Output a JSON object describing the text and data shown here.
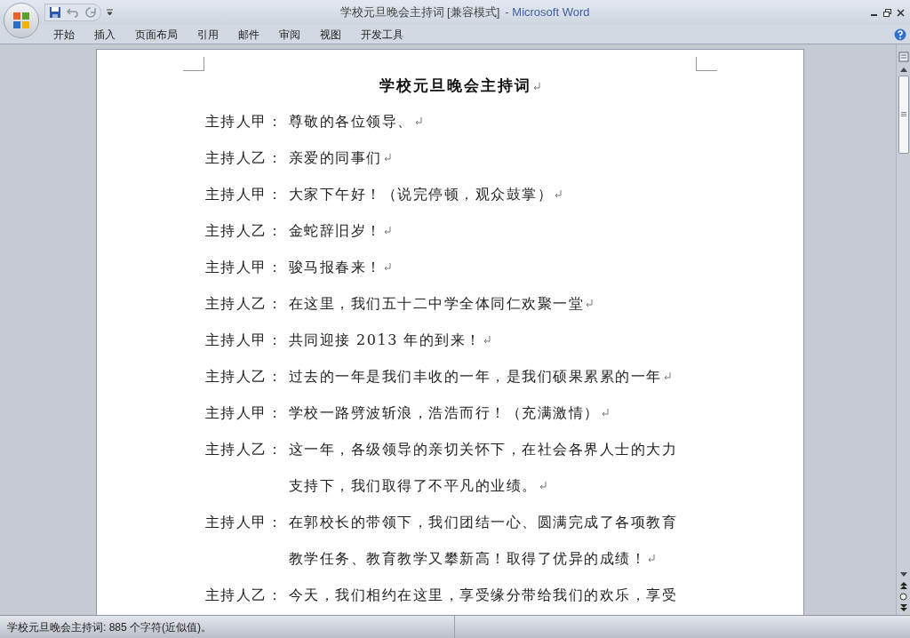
{
  "window": {
    "title": "学校元旦晚会主持词 [兼容模式]",
    "separator": "-",
    "app": "Microsoft Word"
  },
  "tabs": [
    {
      "label": "开始",
      "selected": false
    },
    {
      "label": "插入",
      "selected": false
    },
    {
      "label": "页面布局",
      "selected": false
    },
    {
      "label": "引用",
      "selected": false
    },
    {
      "label": "邮件",
      "selected": false
    },
    {
      "label": "审阅",
      "selected": false
    },
    {
      "label": "视图",
      "selected": false
    },
    {
      "label": "开发工具",
      "selected": false
    }
  ],
  "document": {
    "show_marks": true,
    "title": "学校元旦晚会主持词",
    "paragraphs": [
      {
        "speaker": "主持人甲：",
        "lines": [
          "尊敬的各位领导、"
        ]
      },
      {
        "speaker": "主持人乙：",
        "lines": [
          "亲爱的同事们"
        ]
      },
      {
        "speaker": "主持人甲：",
        "lines": [
          "大家下午好！（说完停顿，观众鼓掌）"
        ]
      },
      {
        "speaker": "主持人乙：",
        "lines": [
          "金蛇辞旧岁！"
        ]
      },
      {
        "speaker": "主持人甲：",
        "lines": [
          "骏马报春来！"
        ]
      },
      {
        "speaker": "主持人乙：",
        "lines": [
          "在这里，我们五十二中学全体同仁欢聚一堂"
        ]
      },
      {
        "speaker": "主持人甲：",
        "lines": [
          "共同迎接 2013 年的到来！"
        ]
      },
      {
        "speaker": "主持人乙：",
        "lines": [
          "过去的一年是我们丰收的一年，是我们硕果累累的一年"
        ]
      },
      {
        "speaker": "主持人甲：",
        "lines": [
          "学校一路劈波斩浪，浩浩而行！（充满激情）"
        ]
      },
      {
        "speaker": "主持人乙：",
        "lines": [
          "这一年，各级领导的亲切关怀下，在社会各界人士的大力",
          "支持下，我们取得了不平凡的业绩。"
        ]
      },
      {
        "speaker": "主持人甲：",
        "lines": [
          "在郭校长的带领下，我们团结一心、圆满完成了各项教育",
          "教学任务、教育教学又攀新高！取得了优异的成绩！"
        ]
      },
      {
        "speaker": "主持人乙：",
        "lines": [
          "今天，我们相约在这里，享受缘分带给我们的欢乐，享受"
        ],
        "end_mark": false
      }
    ]
  },
  "status_bar": {
    "text": "学校元旦晚会主持词: 885 个字符(近似值)。"
  }
}
